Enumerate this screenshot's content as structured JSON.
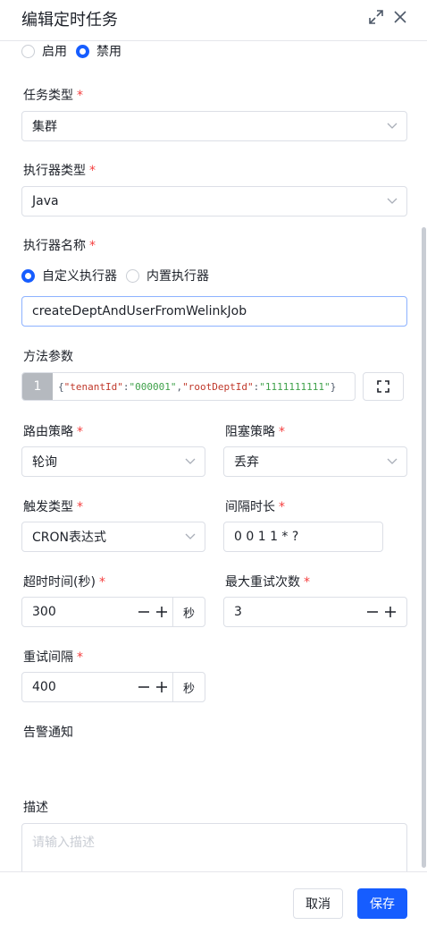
{
  "dialog": {
    "title": "编辑定时任务"
  },
  "status": {
    "options": [
      "启用",
      "禁用"
    ],
    "selected": "禁用"
  },
  "task_type": {
    "label": "任务类型",
    "value": "集群"
  },
  "executor_type": {
    "label": "执行器类型",
    "value": "Java"
  },
  "executor_name": {
    "label": "执行器名称",
    "options": [
      "自定义执行器",
      "内置执行器"
    ],
    "selected": "自定义执行器",
    "value": "createDeptAndUserFromWelinkJob"
  },
  "method_params": {
    "label": "方法参数",
    "line_number": "1",
    "code": {
      "open": "{",
      "key1": "\"tenantId\"",
      "colon": ":",
      "val1": "\"000001\"",
      "comma": ",",
      "key2": "\"rootDeptId\"",
      "val2": "\"1111111111\"",
      "close": "}"
    }
  },
  "route_strategy": {
    "label": "路由策略",
    "value": "轮询"
  },
  "block_strategy": {
    "label": "阻塞策略",
    "value": "丢弃"
  },
  "trigger_type": {
    "label": "触发类型",
    "value": "CRON表达式"
  },
  "interval": {
    "label": "间隔时长",
    "value": "0 0 1 1 * ?"
  },
  "timeout": {
    "label": "超时时间(秒)",
    "value": "300",
    "unit": "秒"
  },
  "max_retry": {
    "label": "最大重试次数",
    "value": "3"
  },
  "retry_interval": {
    "label": "重试间隔",
    "value": "400",
    "unit": "秒"
  },
  "alert": {
    "label": "告警通知"
  },
  "description": {
    "label": "描述",
    "placeholder": "请输入描述"
  },
  "footer": {
    "cancel_label": "取消",
    "save_label": "保存"
  },
  "colors": {
    "primary": "#165dff",
    "required": "#f53f3f",
    "border": "#dcdfe6"
  }
}
